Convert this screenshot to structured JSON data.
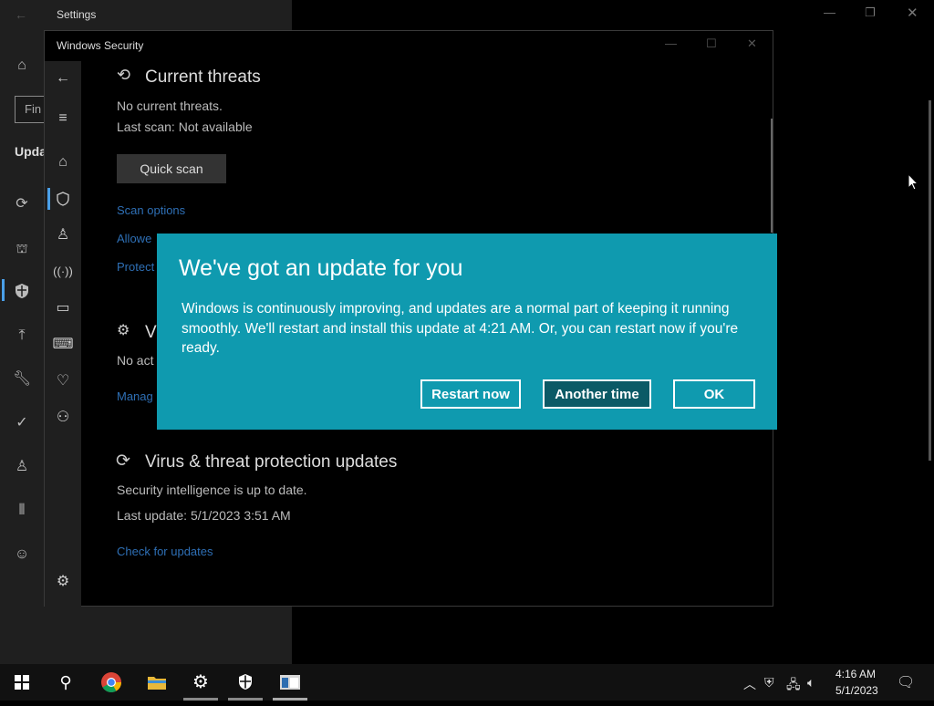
{
  "settings": {
    "title": "Settings",
    "search_placeholder": "Fin",
    "section_label": "Upda",
    "back_icon": "back-arrow-icon",
    "nav_icons": [
      "home-icon",
      "sync-icon",
      "delivery-icon",
      "shield-icon",
      "upload-icon",
      "wrench-icon",
      "check-circle-icon",
      "person-icon",
      "tools-icon",
      "cat-icon"
    ]
  },
  "windows_security": {
    "title": "Windows Security",
    "current_threats": {
      "heading": "Current threats",
      "status": "No current threats.",
      "last_scan": "Last scan: Not available",
      "quick_scan_label": "Quick scan",
      "links": [
        "Scan options",
        "Allowe",
        "Protect"
      ]
    },
    "settings_section": {
      "heading_partial": "V",
      "text_partial": "No act",
      "link_partial": "Manag"
    },
    "updates": {
      "heading": "Virus & threat protection updates",
      "status": "Security intelligence is up to date.",
      "last_update": "Last update: 5/1/2023 3:51 AM",
      "check_link": "Check for updates"
    }
  },
  "dialog": {
    "title": "We've got an update for you",
    "body": "Windows is continuously improving, and updates are a normal part of keeping it running smoothly. We'll restart and install this update at 4:21 AM. Or, you can restart now if you're ready.",
    "buttons": {
      "restart": "Restart now",
      "another": "Another time",
      "ok": "OK"
    },
    "background_color": "#0f9aaf"
  },
  "taskbar": {
    "time": "4:16 AM",
    "date": "5/1/2023",
    "pinned": [
      "windows-start-icon",
      "search-icon",
      "chrome-icon",
      "file-explorer-icon",
      "settings-gear-icon",
      "windows-security-icon",
      "app-window-icon"
    ]
  }
}
